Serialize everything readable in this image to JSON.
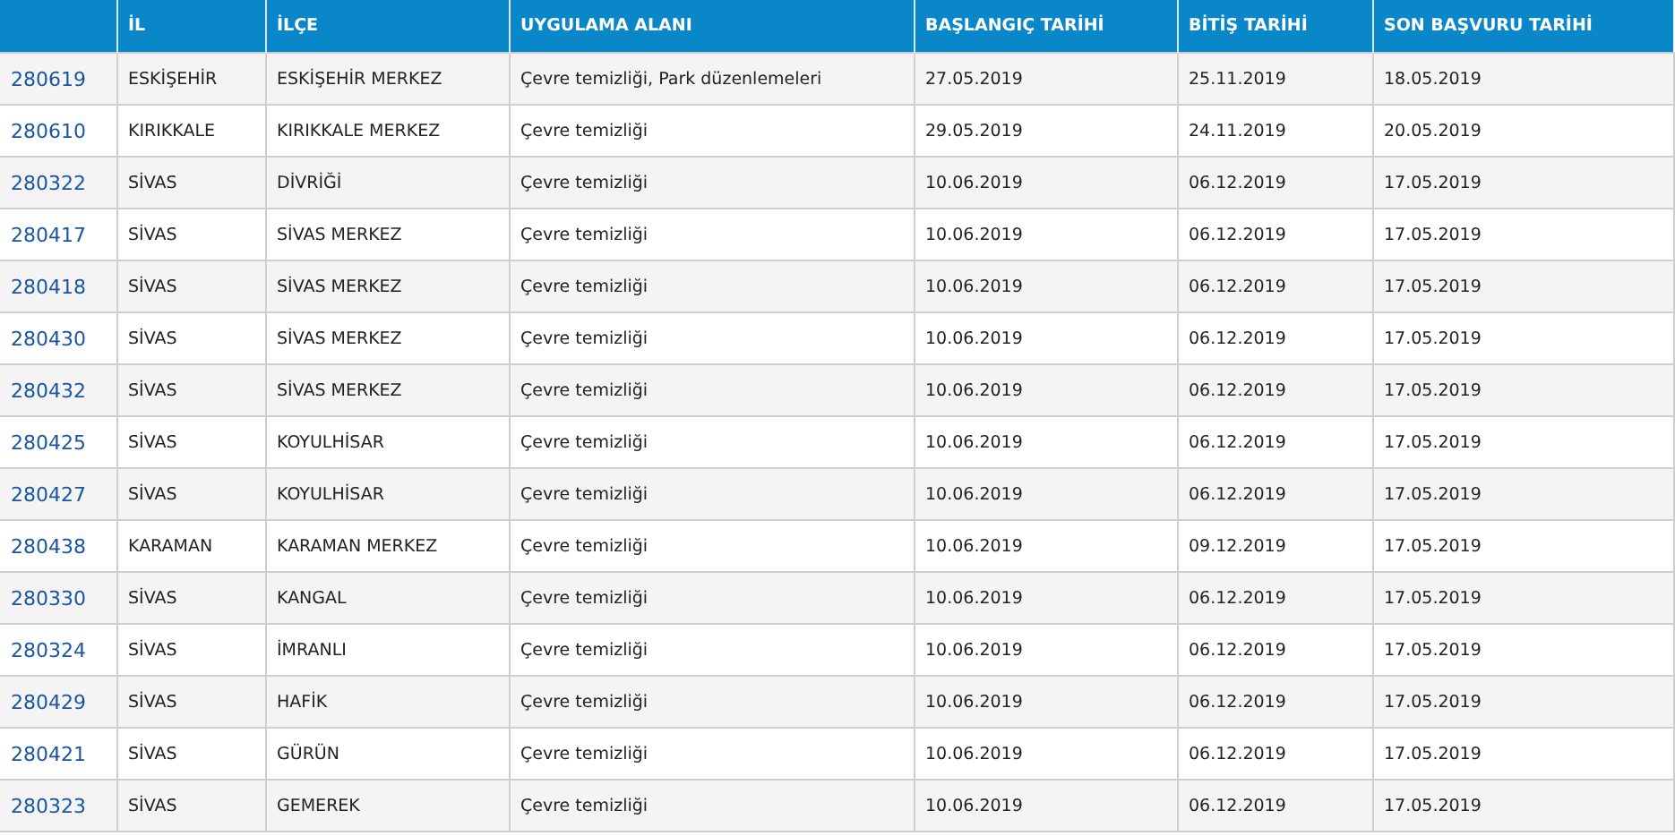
{
  "table": {
    "columns": [
      "",
      "İL",
      "İLÇE",
      "UYGULAMA ALANI",
      "BAŞLANGIÇ TARİHİ",
      "BİTİŞ TARİHİ",
      "SON BAŞVURU TARİHİ"
    ],
    "rows": [
      [
        "280619",
        "ESKİŞEHİR",
        "ESKİŞEHİR MERKEZ",
        "Çevre temizliği, Park düzenlemeleri",
        "27.05.2019",
        "25.11.2019",
        "18.05.2019"
      ],
      [
        "280610",
        "KIRIKKALE",
        "KIRIKKALE MERKEZ",
        "Çevre temizliği",
        "29.05.2019",
        "24.11.2019",
        "20.05.2019"
      ],
      [
        "280322",
        "SİVAS",
        "DİVRİĞİ",
        "Çevre temizliği",
        "10.06.2019",
        "06.12.2019",
        "17.05.2019"
      ],
      [
        "280417",
        "SİVAS",
        "SİVAS MERKEZ",
        "Çevre temizliği",
        "10.06.2019",
        "06.12.2019",
        "17.05.2019"
      ],
      [
        "280418",
        "SİVAS",
        "SİVAS MERKEZ",
        "Çevre temizliği",
        "10.06.2019",
        "06.12.2019",
        "17.05.2019"
      ],
      [
        "280430",
        "SİVAS",
        "SİVAS MERKEZ",
        "Çevre temizliği",
        "10.06.2019",
        "06.12.2019",
        "17.05.2019"
      ],
      [
        "280432",
        "SİVAS",
        "SİVAS MERKEZ",
        "Çevre temizliği",
        "10.06.2019",
        "06.12.2019",
        "17.05.2019"
      ],
      [
        "280425",
        "SİVAS",
        "KOYULHİSAR",
        "Çevre temizliği",
        "10.06.2019",
        "06.12.2019",
        "17.05.2019"
      ],
      [
        "280427",
        "SİVAS",
        "KOYULHİSAR",
        "Çevre temizliği",
        "10.06.2019",
        "06.12.2019",
        "17.05.2019"
      ],
      [
        "280438",
        "KARAMAN",
        "KARAMAN MERKEZ",
        "Çevre temizliği",
        "10.06.2019",
        "09.12.2019",
        "17.05.2019"
      ],
      [
        "280330",
        "SİVAS",
        "KANGAL",
        "Çevre temizliği",
        "10.06.2019",
        "06.12.2019",
        "17.05.2019"
      ],
      [
        "280324",
        "SİVAS",
        "İMRANLI",
        "Çevre temizliği",
        "10.06.2019",
        "06.12.2019",
        "17.05.2019"
      ],
      [
        "280429",
        "SİVAS",
        "HAFİK",
        "Çevre temizliği",
        "10.06.2019",
        "06.12.2019",
        "17.05.2019"
      ],
      [
        "280421",
        "SİVAS",
        "GÜRÜN",
        "Çevre temizliği",
        "10.06.2019",
        "06.12.2019",
        "17.05.2019"
      ],
      [
        "280323",
        "SİVAS",
        "GEMEREK",
        "Çevre temizliği",
        "10.06.2019",
        "06.12.2019",
        "17.05.2019"
      ]
    ]
  }
}
